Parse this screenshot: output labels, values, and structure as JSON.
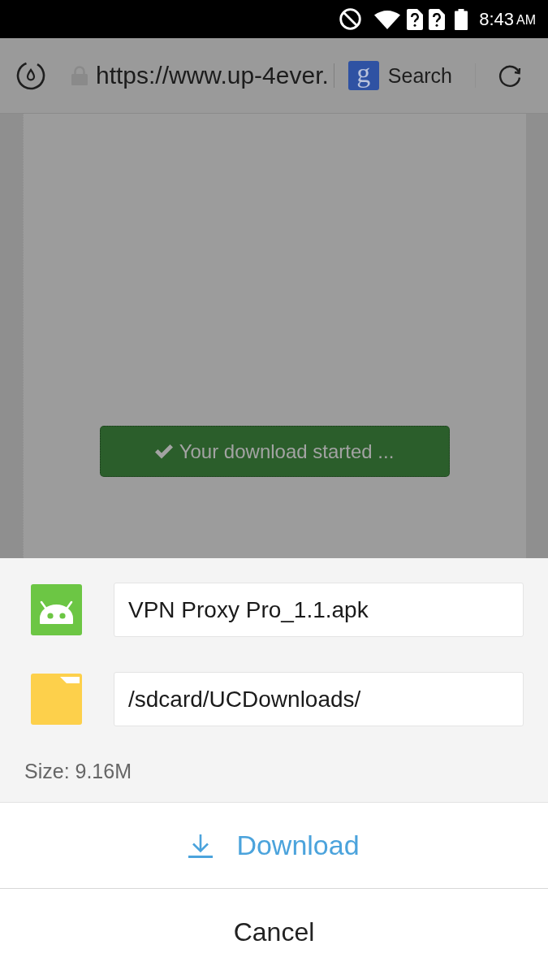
{
  "status_bar": {
    "time": "8:43",
    "meridiem": "AM"
  },
  "toolbar": {
    "url": "https://www.up-4ever.",
    "search_logo": "g",
    "search_placeholder": "Search"
  },
  "page": {
    "banner": "Your download started ..."
  },
  "download_sheet": {
    "fields": [
      {
        "kind": "file",
        "value": "VPN Proxy Pro_1.1.apk"
      },
      {
        "kind": "folder",
        "value": "/sdcard/UCDownloads/"
      }
    ],
    "size": "Size: 9.16M",
    "actions": [
      {
        "kind": "primary",
        "label": "Download"
      },
      {
        "kind": "secondary",
        "label": "Cancel"
      }
    ]
  }
}
